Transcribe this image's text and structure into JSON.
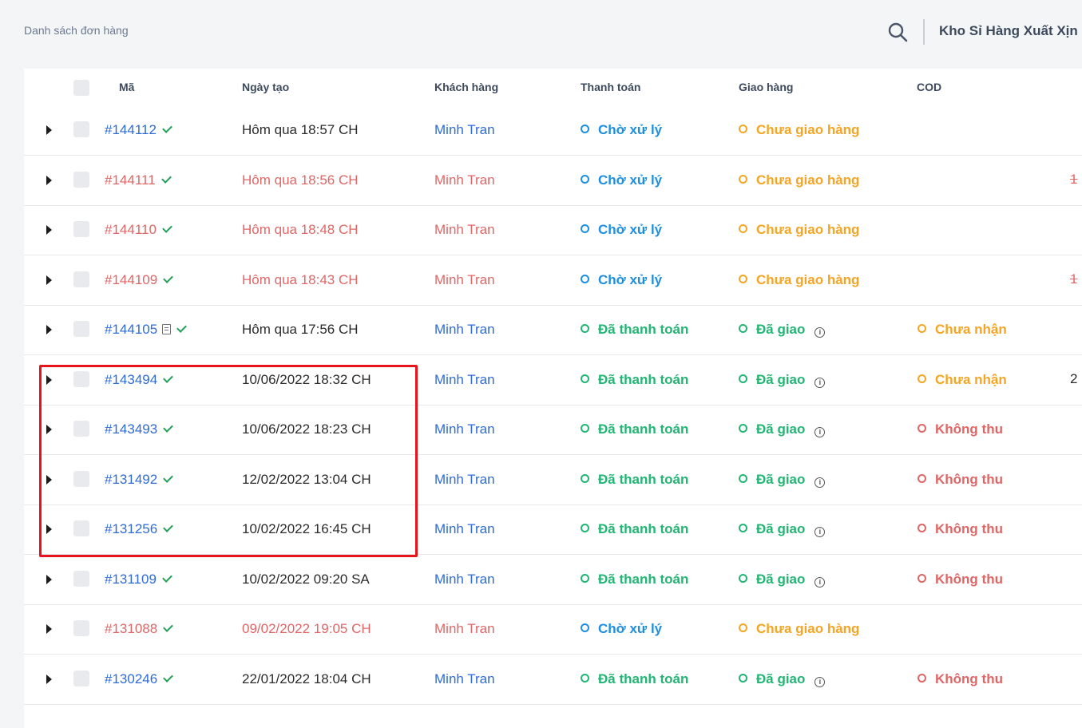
{
  "header": {
    "breadcrumb": "Danh sách đơn hàng",
    "store_name": "Kho Sỉ Hàng Xuất Xịn"
  },
  "table": {
    "columns": [
      "Mã",
      "Ngày tạo",
      "Khách hàng",
      "Thanh toán",
      "Giao hàng",
      "COD"
    ],
    "rows": [
      {
        "code": "#144112",
        "doc": false,
        "date": "Hôm qua 18:57 CH",
        "customer": "Minh Tran",
        "payment": "Chờ xử lý",
        "shipping": "Chưa giao hàng",
        "shipping_info": false,
        "cod": "",
        "extra": "",
        "highlight": false
      },
      {
        "code": "#144111",
        "doc": false,
        "date": "Hôm qua 18:56 CH",
        "customer": "Minh Tran",
        "payment": "Chờ xử lý",
        "shipping": "Chưa giao hàng",
        "shipping_info": false,
        "cod": "",
        "extra": "1",
        "extra_strike": true,
        "highlight": true
      },
      {
        "code": "#144110",
        "doc": false,
        "date": "Hôm qua 18:48 CH",
        "customer": "Minh Tran",
        "payment": "Chờ xử lý",
        "shipping": "Chưa giao hàng",
        "shipping_info": false,
        "cod": "",
        "extra": "",
        "highlight": true
      },
      {
        "code": "#144109",
        "doc": false,
        "date": "Hôm qua 18:43 CH",
        "customer": "Minh Tran",
        "payment": "Chờ xử lý",
        "shipping": "Chưa giao hàng",
        "shipping_info": false,
        "cod": "",
        "extra": "1",
        "extra_strike": true,
        "highlight": true
      },
      {
        "code": "#144105",
        "doc": true,
        "date": "Hôm qua 17:56 CH",
        "customer": "Minh Tran",
        "payment": "Đã thanh toán",
        "shipping": "Đã giao",
        "shipping_info": true,
        "cod": "Chưa nhận",
        "extra": "",
        "highlight": false
      },
      {
        "code": "#143494",
        "doc": false,
        "date": "10/06/2022 18:32 CH",
        "customer": "Minh Tran",
        "payment": "Đã thanh toán",
        "shipping": "Đã giao",
        "shipping_info": true,
        "cod": "Chưa nhận",
        "extra": "2",
        "extra_strike": false,
        "highlight": false
      },
      {
        "code": "#143493",
        "doc": false,
        "date": "10/06/2022 18:23 CH",
        "customer": "Minh Tran",
        "payment": "Đã thanh toán",
        "shipping": "Đã giao",
        "shipping_info": true,
        "cod": "Không thu",
        "extra": "",
        "highlight": false
      },
      {
        "code": "#131492",
        "doc": false,
        "date": "12/02/2022 13:04 CH",
        "customer": "Minh Tran",
        "payment": "Đã thanh toán",
        "shipping": "Đã giao",
        "shipping_info": true,
        "cod": "Không thu",
        "extra": "",
        "highlight": false
      },
      {
        "code": "#131256",
        "doc": false,
        "date": "10/02/2022 16:45 CH",
        "customer": "Minh Tran",
        "payment": "Đã thanh toán",
        "shipping": "Đã giao",
        "shipping_info": true,
        "cod": "Không thu",
        "extra": "",
        "highlight": false
      },
      {
        "code": "#131109",
        "doc": false,
        "date": "10/02/2022 09:20 SA",
        "customer": "Minh Tran",
        "payment": "Đã thanh toán",
        "shipping": "Đã giao",
        "shipping_info": true,
        "cod": "Không thu",
        "extra": "",
        "highlight": false
      },
      {
        "code": "#131088",
        "doc": false,
        "date": "09/02/2022 19:05 CH",
        "customer": "Minh Tran",
        "payment": "Chờ xử lý",
        "shipping": "Chưa giao hàng",
        "shipping_info": false,
        "cod": "",
        "extra": "",
        "highlight": true
      },
      {
        "code": "#130246",
        "doc": false,
        "date": "22/01/2022 18:04 CH",
        "customer": "Minh Tran",
        "payment": "Đã thanh toán",
        "shipping": "Đã giao",
        "shipping_info": true,
        "cod": "Không thu",
        "extra": "",
        "highlight": false
      }
    ]
  },
  "colors": {
    "link_blue": "#2f6bd8",
    "danger_red": "#e06666",
    "pending_blue": "#1e8fe0",
    "pending_orange": "#f5a524",
    "success_green": "#22b573",
    "text_dark": "#2b2b2b",
    "highlight_box": "#e8141b"
  }
}
